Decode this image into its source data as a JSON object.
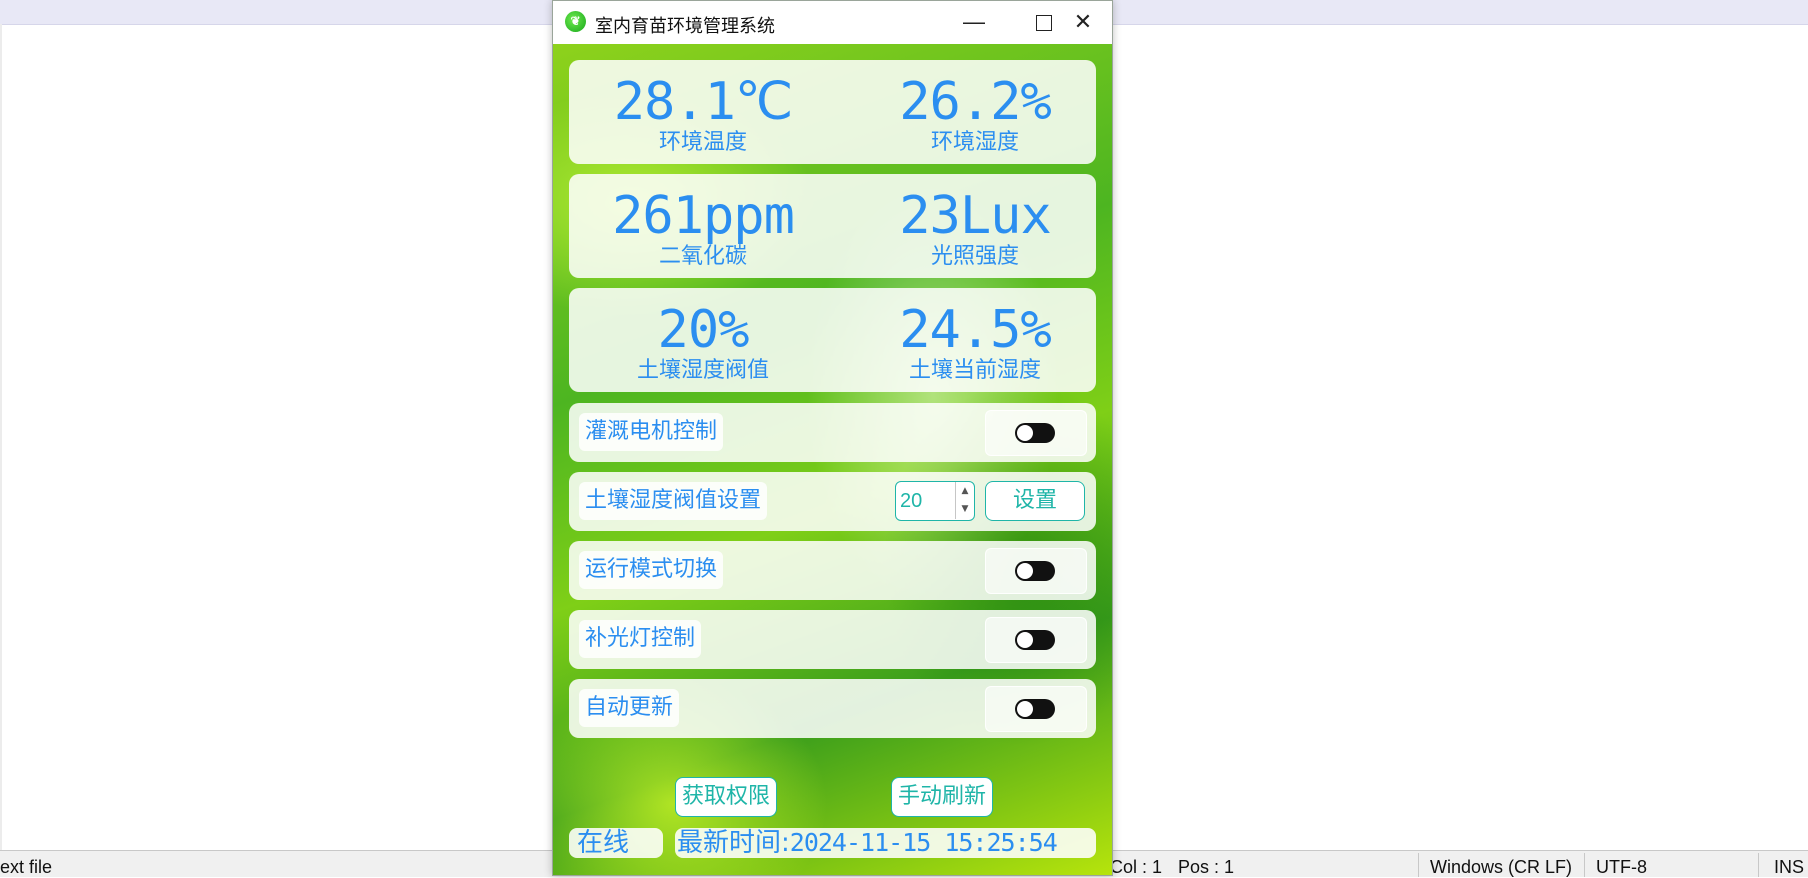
{
  "window": {
    "title": "室内育苗环境管理系统"
  },
  "readings": {
    "temperature": {
      "value": "28.1℃",
      "label": "环境温度"
    },
    "humidity": {
      "value": "26.2%",
      "label": "环境湿度"
    },
    "co2": {
      "value": "261ppm",
      "label": "二氧化碳"
    },
    "light": {
      "value": "23Lux",
      "label": "光照强度"
    },
    "soil_threshold": {
      "value": "20%",
      "label": "土壤湿度阀值"
    },
    "soil_current": {
      "value": "24.5%",
      "label": "土壤当前湿度"
    }
  },
  "controls": {
    "pump": {
      "label": "灌溉电机控制",
      "state": "off"
    },
    "threshold_setting": {
      "label": "土壤湿度阀值设置",
      "value": "20",
      "button": "设置"
    },
    "mode": {
      "label": "运行模式切换",
      "state": "off"
    },
    "fill_light": {
      "label": "补光灯控制",
      "state": "off"
    },
    "auto_update": {
      "label": "自动更新",
      "state": "off"
    }
  },
  "actions": {
    "get_permission": "获取权限",
    "manual_refresh": "手动刷新"
  },
  "status": {
    "online": "在线",
    "time_label": "最新时间:",
    "time_value": "2024-11-15  15:25:54"
  },
  "background_editor": {
    "status_left": "ext file",
    "status_col": "Col : 1",
    "status_pos": "Pos : 1",
    "status_eol": "Windows (CR LF)",
    "status_encoding": "UTF-8",
    "status_ins": "INS"
  },
  "colors": {
    "value_text": "#2b8ef0",
    "button_border": "#1fb5a8",
    "background_green": "#4db521"
  },
  "icons": {
    "app": "seedling-logo-icon",
    "minimize": "minimize-icon",
    "maximize": "maximize-icon",
    "close": "close-icon"
  }
}
